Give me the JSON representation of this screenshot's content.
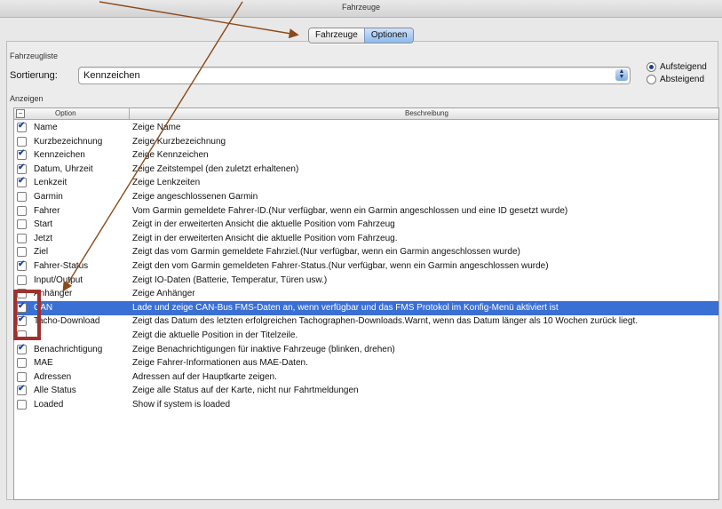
{
  "window": {
    "title": "Fahrzeuge"
  },
  "tabs": [
    {
      "label": "Fahrzeuge"
    },
    {
      "label": "Optionen"
    }
  ],
  "sections": {
    "vehicle_list": "Fahrzeugliste",
    "display": "Anzeigen"
  },
  "sort": {
    "label": "Sortierung:",
    "value": "Kennzeichen"
  },
  "order": {
    "ascending": "Aufsteigend",
    "descending": "Absteigend",
    "selected": "Aufsteigend"
  },
  "table": {
    "headers": {
      "option": "Option",
      "description": "Beschreibung"
    },
    "rows": [
      {
        "option": "Name",
        "description": "Zeige Name",
        "checked": true
      },
      {
        "option": "Kurzbezeichnung",
        "description": "Zeige Kurzbezeichnung",
        "checked": false
      },
      {
        "option": "Kennzeichen",
        "description": "Zeige Kennzeichen",
        "checked": true
      },
      {
        "option": "Datum, Uhrzeit",
        "description": "Zeige Zeitstempel (den zuletzt erhaltenen)",
        "checked": true
      },
      {
        "option": "Lenkzeit",
        "description": "Zeige Lenkzeiten",
        "checked": true
      },
      {
        "option": "Garmin",
        "description": "Zeige angeschlossenen Garmin",
        "checked": false
      },
      {
        "option": "Fahrer",
        "description": "Vom Garmin gemeldete Fahrer-ID.(Nur verfügbar, wenn ein Garmin angeschlossen und eine ID gesetzt wurde)",
        "checked": false
      },
      {
        "option": "Start",
        "description": "Zeigt in der erweiterten Ansicht die aktuelle Position vom Fahrzeug",
        "checked": false
      },
      {
        "option": "Jetzt",
        "description": "Zeigt in der erweiterten Ansicht die aktuelle Position vom Fahrzeug.",
        "checked": false
      },
      {
        "option": "Ziel",
        "description": "Zeigt das vom Garmin gemeldete Fahrziel.(Nur verfügbar, wenn ein Garmin angeschlossen wurde)",
        "checked": false
      },
      {
        "option": "Fahrer-Status",
        "description": "Zeigt den vom Garmin gemeldeten Fahrer-Status.(Nur verfügbar, wenn ein Garmin angeschlossen wurde)",
        "checked": true
      },
      {
        "option": "Input/Output",
        "description": "Zeigt IO-Daten (Batterie, Temperatur, Türen usw.)",
        "checked": false
      },
      {
        "option": "Anhänger",
        "description": "Zeige Anhänger",
        "checked": false
      },
      {
        "option": "CAN",
        "description": "Lade und zeige CAN-Bus FMS-Daten an, wenn verfügbar und das FMS Protokol im Konfig-Menü aktiviert ist",
        "checked": true,
        "selected": true
      },
      {
        "option": "Tacho-Download",
        "description": "Zeigt das Datum des letzten erfolgreichen Tachographen-Downloads.Warnt, wenn das Datum länger als 10 Wochen zurück liegt.",
        "checked": true
      },
      {
        "option": "",
        "description": "Zeigt die aktuelle Position in der Titelzeile.",
        "checked": false
      },
      {
        "option": "Benachrichtigung",
        "description": "Zeige Benachrichtigungen für inaktive Fahrzeuge (blinken, drehen)",
        "checked": true
      },
      {
        "option": "MAE",
        "description": "Zeige Fahrer-Informationen aus MAE-Daten.",
        "checked": false
      },
      {
        "option": "Adressen",
        "description": "Adressen auf der Hauptkarte zeigen.",
        "checked": false
      },
      {
        "option": "Alle Status",
        "description": "Zeige alle Status auf der Karte, nicht nur Fahrtmeldungen",
        "checked": true
      },
      {
        "option": "Loaded",
        "description": "Show if system is loaded",
        "checked": false
      }
    ]
  },
  "colors": {
    "selection": "#3a6fd4",
    "annotation_box": "#a0312e",
    "arrow": "#8a4a1a"
  }
}
